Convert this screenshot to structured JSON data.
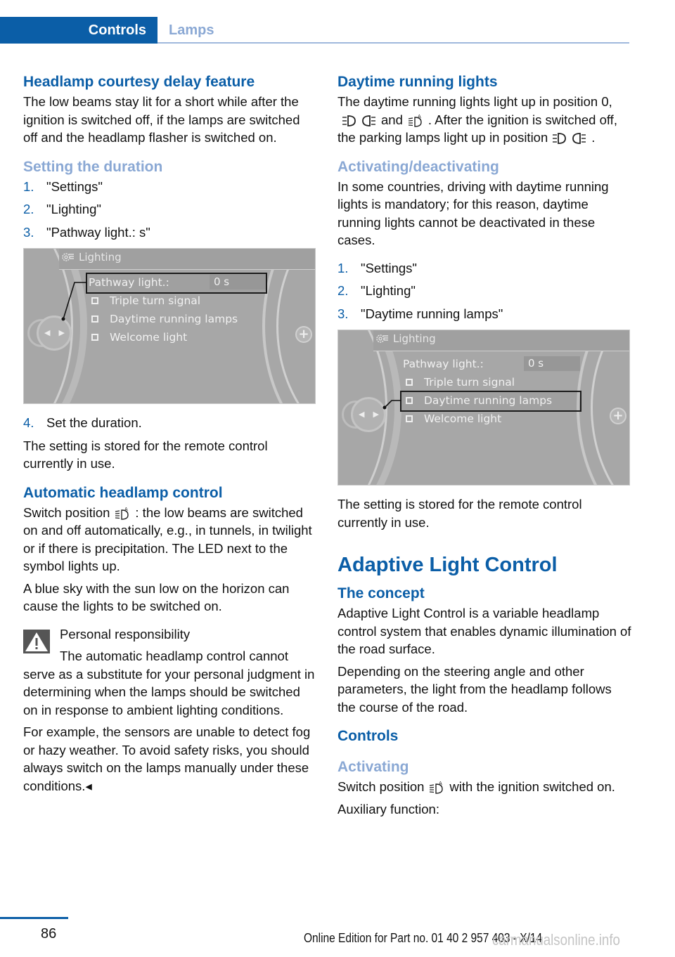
{
  "header": {
    "section": "Controls",
    "subsection": "Lamps"
  },
  "colors": {
    "accent": "#0b5ea7",
    "subheading": "#8aa8d4",
    "screen_bg": "#a7a7a7"
  },
  "left": {
    "h_courtesy": "Headlamp courtesy delay feature",
    "p_courtesy": "The low beams stay lit for a short while after the ignition is switched off, if the lamps are switched off and the headlamp flasher is switched on.",
    "h_duration": "Setting the duration",
    "steps": [
      {
        "num": "1.",
        "text": "\"Settings\""
      },
      {
        "num": "2.",
        "text": "\"Lighting\""
      },
      {
        "num": "3.",
        "text": "\"Pathway light.: s\""
      }
    ],
    "screen": {
      "title": "Lighting",
      "pathway_label": "Pathway light.:",
      "pathway_value": "0 s",
      "options": [
        "Triple turn signal",
        "Daytime running lamps",
        "Welcome light"
      ],
      "highlighted": "Pathway light.:"
    },
    "step4": {
      "num": "4.",
      "text": "Set the duration."
    },
    "p_stored": "The setting is stored for the remote control currently in use.",
    "h_auto": "Automatic headlamp control",
    "p_auto_a": "Switch position",
    "p_auto_b": ": the low beams are switched on and off automatically, e.g., in tunnels, in twilight or if there is precipitation. The LED next to the symbol lights up.",
    "p_bluesky": "A blue sky with the sun low on the horizon can cause the lights to be switched on.",
    "warning": {
      "title": "Personal responsibility",
      "text": "The automatic headlamp control cannot serve as a substitute for your personal judgment in determining when the lamps should be switched on in response to ambient lighting conditions.",
      "p2": "For example, the sensors are unable to detect fog or hazy weather. To avoid safety risks, you should always switch on the lamps manually under these conditions.◂"
    }
  },
  "right": {
    "h_drl": "Daytime running lights",
    "p_drl_1": "The daytime running lights light up in position 0,",
    "p_drl_and": "and",
    "p_drl_2": ". After the ignition is switched off, the parking lamps light up in position",
    "p_drl_end": ".",
    "h_activ": "Activating/deactivating",
    "p_activ": "In some countries, driving with daytime running lights is mandatory; for this reason, daytime running lights cannot be deactivated in these cases.",
    "steps": [
      {
        "num": "1.",
        "text": "\"Settings\""
      },
      {
        "num": "2.",
        "text": "\"Lighting\""
      },
      {
        "num": "3.",
        "text": "\"Daytime running lamps\""
      }
    ],
    "screen": {
      "title": "Lighting",
      "pathway_label": "Pathway light.:",
      "pathway_value": "0 s",
      "options": [
        "Triple turn signal",
        "Daytime running lamps",
        "Welcome light"
      ],
      "highlighted": "Daytime running lamps"
    },
    "p_stored": "The setting is stored for the remote control currently in use.",
    "h_alc": "Adaptive Light Control",
    "h_concept": "The concept",
    "p_concept": "Adaptive Light Control is a variable headlamp control system that enables dynamic illumination of the road surface.",
    "p_steering": "Depending on the steering angle and other parameters, the light from the headlamp follows the course of the road.",
    "h_controls": "Controls",
    "h_activating": "Activating",
    "p_switch_a": "Switch position",
    "p_switch_b": "with the ignition switched on.",
    "p_aux": "Auxiliary function:"
  },
  "icons": {
    "parking": "parking-lights-icon",
    "auto": "automatic-headlamp-icon",
    "settings": "gear-icon",
    "warning": "warning-triangle-icon"
  },
  "footer": {
    "page": "86",
    "edition": "Online Edition for Part no. 01 40 2 957 403 - X/14",
    "watermark": "carmanualsonline.info"
  }
}
